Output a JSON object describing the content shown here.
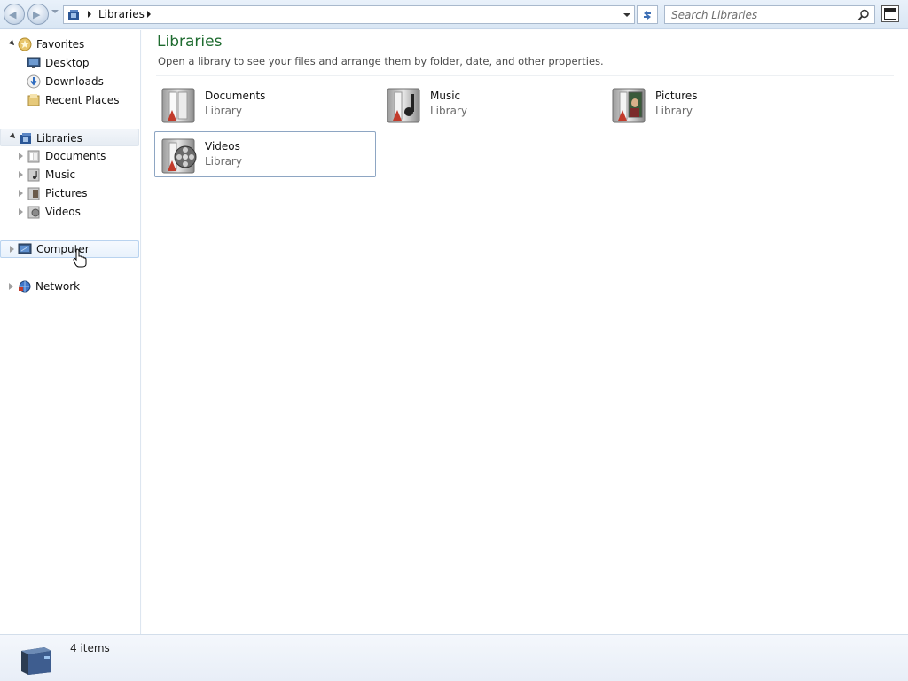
{
  "window": {
    "breadcrumb": [
      "Libraries"
    ],
    "search_placeholder": "Search Libraries"
  },
  "sidebar": {
    "favorites": {
      "label": "Favorites",
      "items": [
        "Desktop",
        "Downloads",
        "Recent Places"
      ]
    },
    "libraries": {
      "label": "Libraries",
      "items": [
        "Documents",
        "Music",
        "Pictures",
        "Videos"
      ]
    },
    "computer": {
      "label": "Computer"
    },
    "network": {
      "label": "Network"
    }
  },
  "main": {
    "title": "Libraries",
    "subtitle": "Open a library to see your files and arrange them by folder, date, and other properties.",
    "libraries": [
      {
        "name": "Documents",
        "type": "Library",
        "icon": "documents-library-icon"
      },
      {
        "name": "Music",
        "type": "Library",
        "icon": "music-library-icon"
      },
      {
        "name": "Pictures",
        "type": "Library",
        "icon": "pictures-library-icon"
      },
      {
        "name": "Videos",
        "type": "Library",
        "icon": "videos-library-icon"
      }
    ]
  },
  "details": {
    "count_text": "4 items"
  },
  "colors": {
    "title_green": "#1e6b2f",
    "accent_blue": "#2b5797"
  }
}
